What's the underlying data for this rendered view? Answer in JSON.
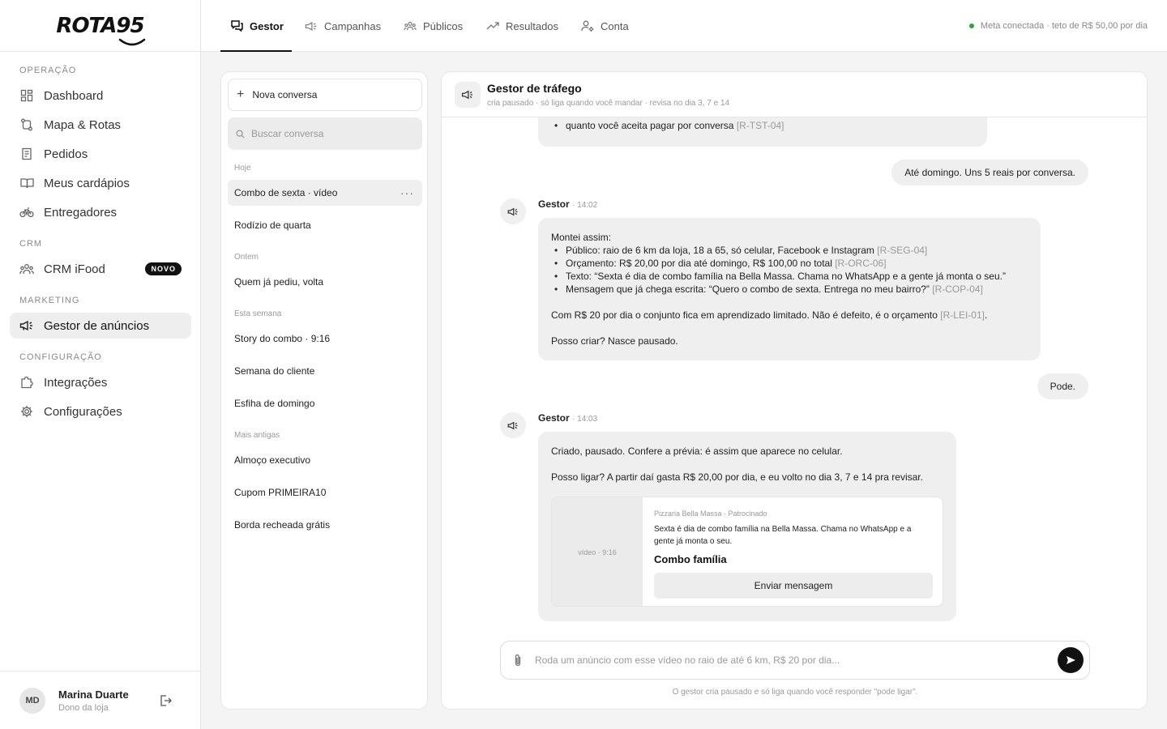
{
  "brand": {
    "logo_text": "ROTA95"
  },
  "sidebar": {
    "sections": {
      "operacao": "OPERAÇÃO",
      "crm": "CRM",
      "marketing": "MARKETING",
      "config": "CONFIGURAÇÃO"
    },
    "items": [
      {
        "label": "Dashboard",
        "icon": "grid-icon"
      },
      {
        "label": "Mapa & Rotas",
        "icon": "route-icon"
      },
      {
        "label": "Pedidos",
        "icon": "receipt-icon"
      },
      {
        "label": "Meus cardápios",
        "icon": "book-icon"
      },
      {
        "label": "Entregadores",
        "icon": "bike-icon"
      },
      {
        "label": "CRM iFood",
        "icon": "users-icon",
        "badge": "NOVO"
      },
      {
        "label": "Gestor de anúncios",
        "icon": "megaphone-icon",
        "active": true
      },
      {
        "label": "Integrações",
        "icon": "puzzle-icon"
      },
      {
        "label": "Configurações",
        "icon": "gear-icon"
      }
    ],
    "user": {
      "initials": "MD",
      "name": "Marina Duarte",
      "role": "Dono da loja"
    }
  },
  "topbar": {
    "tabs": [
      {
        "label": "Gestor",
        "icon": "chat-icon",
        "active": true
      },
      {
        "label": "Campanhas",
        "icon": "megaphone-icon"
      },
      {
        "label": "Públicos",
        "icon": "users-icon"
      },
      {
        "label": "Resultados",
        "icon": "trend-icon"
      },
      {
        "label": "Conta",
        "icon": "account-icon"
      }
    ],
    "status": "Meta conectada · teto de R$ 50,00 por dia",
    "status_color": "#2ea043"
  },
  "conversations": {
    "new_label": "Nova conversa",
    "search_placeholder": "Buscar conversa",
    "groups": {
      "today": "Hoje",
      "yesterday": "Ontem",
      "week": "Esta semana",
      "older": "Mais antigas"
    },
    "items": [
      "Combo de sexta · vídeo",
      "Rodízio de quarta",
      "Quem já pediu, volta",
      "Story do combo · 9:16",
      "Semana do cliente",
      "Esfiha de domingo",
      "Almoço executivo",
      "Cupom PRIMEIRA10",
      "Borda recheada grátis"
    ],
    "more": "···"
  },
  "chat": {
    "title": "Gestor de tráfego",
    "subtitle": "cria pausado · só liga quando você mandar · revisa no dia 3, 7 e 14",
    "partial_bullet": "quanto você aceita pagar por conversa",
    "partial_ref": "[R-TST-04]",
    "user_msg_1": "Até domingo. Uns 5 reais por conversa.",
    "bot_name": "Gestor",
    "time_1": "· 14:02",
    "msg2_intro": "Montei assim:",
    "msg2_bullets": [
      {
        "text": "Público: raio de 6 km da loja, 18 a 65, só celular, Facebook e Instagram",
        "ref": "[R-SEG-04]"
      },
      {
        "text": "Orçamento: R$ 20,00 por dia até domingo, R$ 100,00 no total",
        "ref": "[R-ORC-06]"
      },
      {
        "text": "Texto: “Sexta é dia de combo família na Bella Massa. Chama no WhatsApp e a gente já monta o seu.”",
        "ref": ""
      },
      {
        "text": "Mensagem que já chega escrita: “Quero o combo de sexta. Entrega no meu bairro?”",
        "ref": "[R-COP-04]"
      }
    ],
    "msg2_p2": "Com R$ 20 por dia o conjunto fica em aprendizado limitado. Não é defeito, é o orçamento",
    "msg2_p2_ref": "[R-LEI-01]",
    "msg2_p2_end": ".",
    "msg2_p3": "Posso criar? Nasce pausado.",
    "user_msg_2": "Pode.",
    "time_2": "· 14:03",
    "msg3_p1": "Criado, pausado. Confere a prévia: é assim que aparece no celular.",
    "msg3_p2": "Posso ligar? A partir daí gasta R$ 20,00 por dia, e eu volto no dia 3, 7 e 14 pra revisar.",
    "preview": {
      "video_label": "vídeo · 9:16",
      "meta": "Pizzaria Bella Massa · Patrocinado",
      "text": "Sexta é dia de combo família na Bella Massa. Chama no WhatsApp e a gente já monta o seu.",
      "title": "Combo família",
      "button": "Enviar mensagem"
    },
    "composer_placeholder": "Roda um anúncio com esse vídeo no raio de até 6 km, R$ 20 por dia...",
    "footnote": "O gestor cria pausado e só liga quando você responder \"pode ligar\"."
  }
}
